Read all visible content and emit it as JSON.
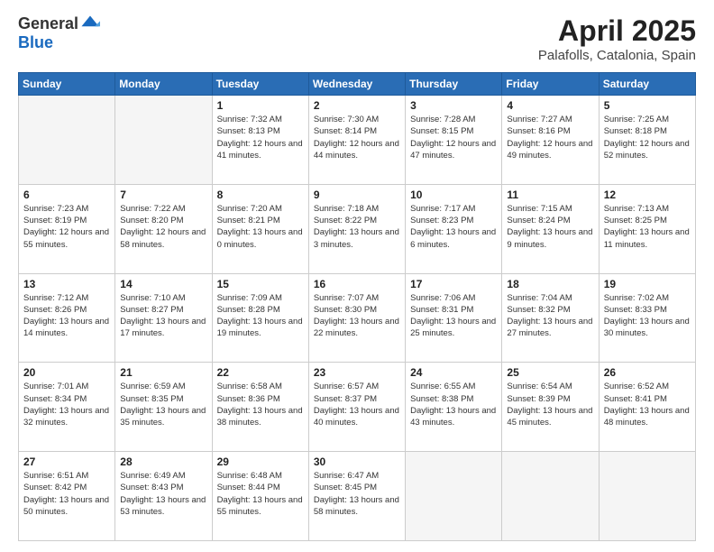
{
  "header": {
    "logo_general": "General",
    "logo_blue": "Blue",
    "title": "April 2025",
    "subtitle": "Palafolls, Catalonia, Spain"
  },
  "calendar": {
    "days_of_week": [
      "Sunday",
      "Monday",
      "Tuesday",
      "Wednesday",
      "Thursday",
      "Friday",
      "Saturday"
    ],
    "weeks": [
      [
        {
          "day": "",
          "empty": true
        },
        {
          "day": "",
          "empty": true
        },
        {
          "day": "1",
          "sunrise": "7:32 AM",
          "sunset": "8:13 PM",
          "daylight": "12 hours and 41 minutes."
        },
        {
          "day": "2",
          "sunrise": "7:30 AM",
          "sunset": "8:14 PM",
          "daylight": "12 hours and 44 minutes."
        },
        {
          "day": "3",
          "sunrise": "7:28 AM",
          "sunset": "8:15 PM",
          "daylight": "12 hours and 47 minutes."
        },
        {
          "day": "4",
          "sunrise": "7:27 AM",
          "sunset": "8:16 PM",
          "daylight": "12 hours and 49 minutes."
        },
        {
          "day": "5",
          "sunrise": "7:25 AM",
          "sunset": "8:18 PM",
          "daylight": "12 hours and 52 minutes."
        }
      ],
      [
        {
          "day": "6",
          "sunrise": "7:23 AM",
          "sunset": "8:19 PM",
          "daylight": "12 hours and 55 minutes."
        },
        {
          "day": "7",
          "sunrise": "7:22 AM",
          "sunset": "8:20 PM",
          "daylight": "12 hours and 58 minutes."
        },
        {
          "day": "8",
          "sunrise": "7:20 AM",
          "sunset": "8:21 PM",
          "daylight": "13 hours and 0 minutes."
        },
        {
          "day": "9",
          "sunrise": "7:18 AM",
          "sunset": "8:22 PM",
          "daylight": "13 hours and 3 minutes."
        },
        {
          "day": "10",
          "sunrise": "7:17 AM",
          "sunset": "8:23 PM",
          "daylight": "13 hours and 6 minutes."
        },
        {
          "day": "11",
          "sunrise": "7:15 AM",
          "sunset": "8:24 PM",
          "daylight": "13 hours and 9 minutes."
        },
        {
          "day": "12",
          "sunrise": "7:13 AM",
          "sunset": "8:25 PM",
          "daylight": "13 hours and 11 minutes."
        }
      ],
      [
        {
          "day": "13",
          "sunrise": "7:12 AM",
          "sunset": "8:26 PM",
          "daylight": "13 hours and 14 minutes."
        },
        {
          "day": "14",
          "sunrise": "7:10 AM",
          "sunset": "8:27 PM",
          "daylight": "13 hours and 17 minutes."
        },
        {
          "day": "15",
          "sunrise": "7:09 AM",
          "sunset": "8:28 PM",
          "daylight": "13 hours and 19 minutes."
        },
        {
          "day": "16",
          "sunrise": "7:07 AM",
          "sunset": "8:30 PM",
          "daylight": "13 hours and 22 minutes."
        },
        {
          "day": "17",
          "sunrise": "7:06 AM",
          "sunset": "8:31 PM",
          "daylight": "13 hours and 25 minutes."
        },
        {
          "day": "18",
          "sunrise": "7:04 AM",
          "sunset": "8:32 PM",
          "daylight": "13 hours and 27 minutes."
        },
        {
          "day": "19",
          "sunrise": "7:02 AM",
          "sunset": "8:33 PM",
          "daylight": "13 hours and 30 minutes."
        }
      ],
      [
        {
          "day": "20",
          "sunrise": "7:01 AM",
          "sunset": "8:34 PM",
          "daylight": "13 hours and 32 minutes."
        },
        {
          "day": "21",
          "sunrise": "6:59 AM",
          "sunset": "8:35 PM",
          "daylight": "13 hours and 35 minutes."
        },
        {
          "day": "22",
          "sunrise": "6:58 AM",
          "sunset": "8:36 PM",
          "daylight": "13 hours and 38 minutes."
        },
        {
          "day": "23",
          "sunrise": "6:57 AM",
          "sunset": "8:37 PM",
          "daylight": "13 hours and 40 minutes."
        },
        {
          "day": "24",
          "sunrise": "6:55 AM",
          "sunset": "8:38 PM",
          "daylight": "13 hours and 43 minutes."
        },
        {
          "day": "25",
          "sunrise": "6:54 AM",
          "sunset": "8:39 PM",
          "daylight": "13 hours and 45 minutes."
        },
        {
          "day": "26",
          "sunrise": "6:52 AM",
          "sunset": "8:41 PM",
          "daylight": "13 hours and 48 minutes."
        }
      ],
      [
        {
          "day": "27",
          "sunrise": "6:51 AM",
          "sunset": "8:42 PM",
          "daylight": "13 hours and 50 minutes."
        },
        {
          "day": "28",
          "sunrise": "6:49 AM",
          "sunset": "8:43 PM",
          "daylight": "13 hours and 53 minutes."
        },
        {
          "day": "29",
          "sunrise": "6:48 AM",
          "sunset": "8:44 PM",
          "daylight": "13 hours and 55 minutes."
        },
        {
          "day": "30",
          "sunrise": "6:47 AM",
          "sunset": "8:45 PM",
          "daylight": "13 hours and 58 minutes."
        },
        {
          "day": "",
          "empty": true
        },
        {
          "day": "",
          "empty": true
        },
        {
          "day": "",
          "empty": true
        }
      ]
    ]
  }
}
